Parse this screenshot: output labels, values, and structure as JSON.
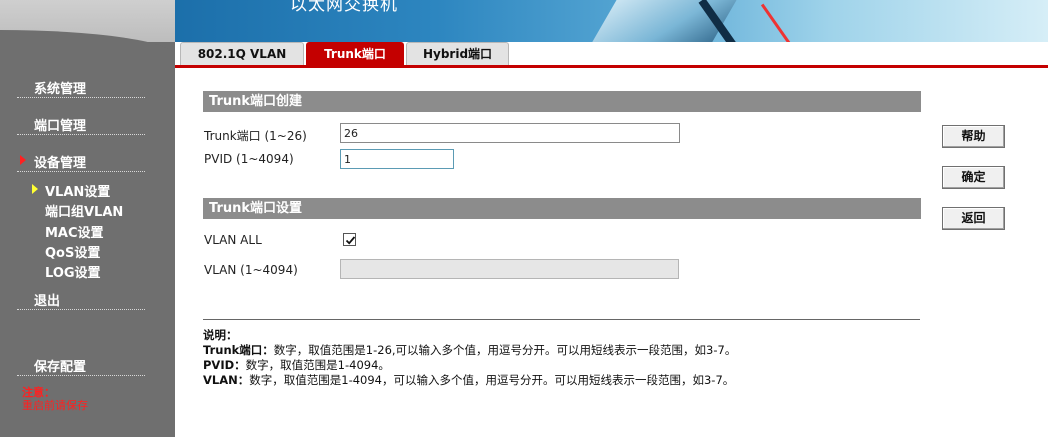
{
  "banner": {
    "title": "以太网交换机"
  },
  "sidebar": {
    "items": [
      {
        "label": "系统管理"
      },
      {
        "label": "端口管理"
      },
      {
        "label": "设备管理"
      }
    ],
    "subitems": [
      {
        "label": "VLAN设置"
      },
      {
        "label": "端口组VLAN"
      },
      {
        "label": "MAC设置"
      },
      {
        "label": "QoS设置"
      },
      {
        "label": "LOG设置"
      }
    ],
    "logout": "退出",
    "save": "保存配置",
    "note_title": "注意：",
    "note_text": "重启前请保存"
  },
  "tabs": [
    {
      "label": "802.1Q VLAN"
    },
    {
      "label": "Trunk端口"
    },
    {
      "label": "Hybrid端口"
    }
  ],
  "create_section": {
    "title": "Trunk端口创建",
    "trunk_port_label": "Trunk端口 (1~26)",
    "trunk_port_value": "26",
    "pvid_label": "PVID (1~4094)",
    "pvid_value": "1"
  },
  "settings_section": {
    "title": "Trunk端口设置",
    "vlan_all_label": "VLAN ALL",
    "vlan_all_checked": true,
    "vlan_label": "VLAN (1~4094)",
    "vlan_value": ""
  },
  "buttons": {
    "help": "帮助",
    "confirm": "确定",
    "back": "返回"
  },
  "notes": {
    "title": "说明：",
    "line1_key": "Trunk端口：",
    "line1_text": "数字，取值范围是1-26,可以输入多个值，用逗号分开。可以用短线表示一段范围，如3-7。",
    "line2_key": "PVID：",
    "line2_text": "数字，取值范围是1-4094。",
    "line3_key": "VLAN：",
    "line3_text": "数字，取值范围是1-4094，可以输入多个值，用逗号分开。可以用短线表示一段范围，如3-7。"
  },
  "colors": {
    "accent": "#c40000",
    "sidebar_bg": "#6f6f6f",
    "section_bg": "#8c8c8c",
    "note_red": "#ff2020"
  }
}
